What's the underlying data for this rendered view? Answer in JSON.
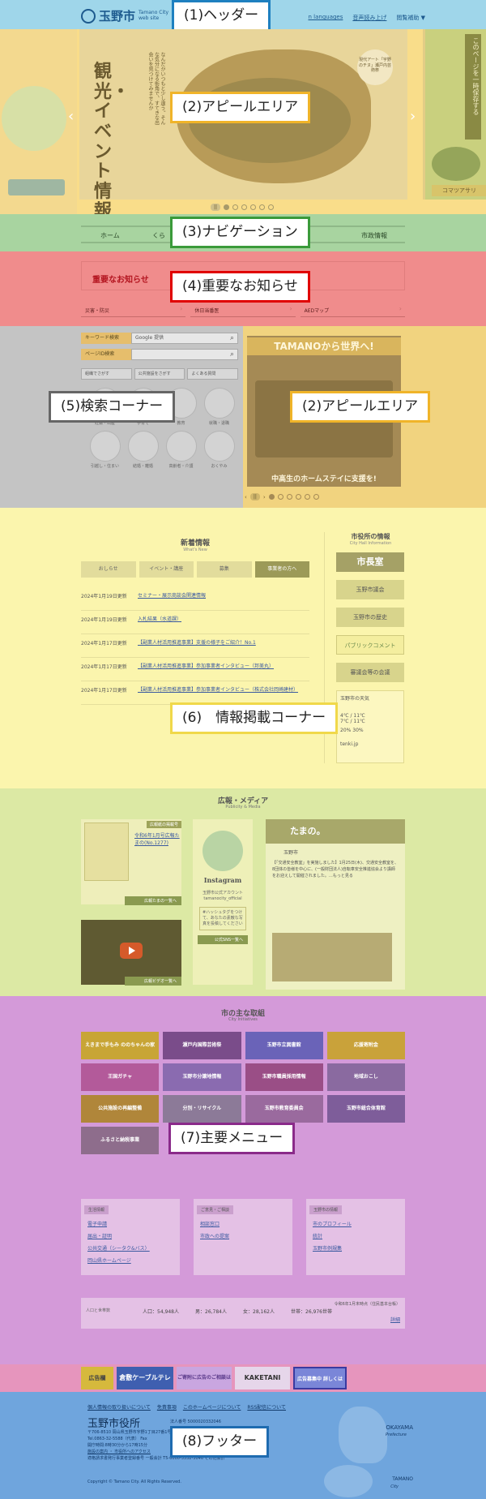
{
  "labels": {
    "header": "(1)ヘッダー",
    "appeal_top": "(2)アピールエリア",
    "nav": "(3)ナビゲーション",
    "important": "(4)重要なお知らせ",
    "search": "(5)検索コーナー",
    "appeal_right": "(2)アピールエリア",
    "info": "(6)　情報掲載コーナー",
    "menu": "(7)主要メニュー",
    "footer": "(8)フッター"
  },
  "header": {
    "logo": "玉野市",
    "logo_sub_1": "Tamano City",
    "logo_sub_2": "web site",
    "links": [
      "n languages",
      "音声読み上げ",
      "閲覧補助 ▼"
    ]
  },
  "appeal": {
    "title": "観光・イベント情報",
    "body": "なんだかいつもと少し違う。そんな気分になる街角で、すてきな出会いを見つけてみませんか",
    "tag": "現代アート「宇野のチヌ」瀬戸内芸術祭",
    "right_vertical": "このページを一時保存する",
    "right_bank": "コマツアサリ",
    "prev": "‹",
    "next": "›",
    "pause": "||"
  },
  "nav": {
    "items": [
      "ホーム",
      "くら",
      "市政情報"
    ]
  },
  "important": {
    "title": "重要なお知らせ",
    "links": [
      "災害・防災",
      "休日当番医",
      "AEDマップ"
    ]
  },
  "search": {
    "keyword_label": "キーワード検索",
    "keyword_placeholder": "Google 提供",
    "page_id_label": "ページID検索",
    "quick": [
      "組織でさがす",
      "公共施設をさがす",
      "よくある質問"
    ],
    "icons": [
      "妊娠・出産",
      "子育て",
      "教育",
      "就職・退職",
      "引越し・住まい",
      "結婚・離婚",
      "高齢者・介護",
      "おくやみ"
    ]
  },
  "appeal2": {
    "banner": "TAMANOから世界へ!",
    "caption": "中高生のホームステイに支援を!",
    "prev": "‹",
    "next": "›",
    "pause": "||"
  },
  "info": {
    "heading": "新着情報",
    "heading_sub": "What's New",
    "tabs": [
      "おしらせ",
      "イベント・講座",
      "募集",
      "事業者の方へ"
    ],
    "news": [
      {
        "date": "2024年1月19日更新",
        "title": "セミナー・展示商談会関連情報"
      },
      {
        "date": "2024年1月19日更新",
        "title": "入札結果（水道課）"
      },
      {
        "date": "2024年1月17日更新",
        "title": "【副業人材活用推進事業】支援の様子をご紹介！No.1"
      },
      {
        "date": "2024年1月17日更新",
        "title": "【副業人材活用推進事業】参加事業者インタビュー（邦美丸）"
      },
      {
        "date": "2024年1月17日更新",
        "title": "【副業人材活用推進事業】参加事業者インタビュー（株式会社岡崎建材）"
      }
    ],
    "side_heading": "市役所の情報",
    "side_sub": "City Hall Information",
    "side_banners": [
      "市長室",
      "玉野市議会",
      "玉野市の歴史",
      "パブリックコメント",
      "審議会等の会議"
    ],
    "weather_title": "玉野市の天気",
    "weather_1": "4℃ / 11℃",
    "weather_2": "7℃ / 11℃",
    "weather_pct_1": "20%",
    "weather_pct_2": "30%",
    "weather_src": "tenki.jp"
  },
  "media": {
    "heading": "広報・メディア",
    "heading_sub": "Publicity & Media",
    "kohou_tag": "広報紙の掲載号",
    "kohou_link": "令和6年1月号広報たまの(No.1277)",
    "kohou_more": "広報たまの一覧へ",
    "video_more": "広報ビデオ一覧へ",
    "insta": "Instagram",
    "insta_text": "玉野市公式アカウント tamanocity_official",
    "insta_note": "#ハッシュタグをつけて、あなたの素敵な写真を投稿してください",
    "insta_more": "公式SNS一覧へ",
    "fb_top": "たまの。",
    "fb_name": "玉野市",
    "fb_body": "【「交通安全教室」を実施しました】1月25日(木)、交通安全教室を、8団体の皆様を中心に、(一般財団法人)自転車安全推進協会より講師をお迎えして開催されました。…もっと見る"
  },
  "menu": {
    "heading": "市の主な取組",
    "heading_sub": "City Initiatives",
    "banners": [
      "えきまで手もみ ののちゃんの家",
      "瀬戸内国際芸術祭",
      "玉野市立図書館",
      "応援寄附金",
      "王国ガチャ",
      "玉野市分譲地情報",
      "玉野市職員採用情報",
      "地域おこし",
      "公共施設の再編整備",
      "分別・リサイクル",
      "玉野市教育委員会",
      "玉野市総合体育館",
      "ふるさと納税事業"
    ],
    "panels": [
      {
        "head": "生活情報",
        "links": [
          "電子申請",
          "届出・証明",
          "公共交通（シータク&バス）",
          "岡山県ホームページ"
        ]
      },
      {
        "head": "ご意見・ご相談",
        "links": [
          "相談窓口",
          "市政への提案"
        ]
      },
      {
        "head": "玉野市の情報",
        "links": [
          "市のプロフィール",
          "統計",
          "玉野市例規集"
        ]
      }
    ],
    "pop_label": "人口と世帯数",
    "pop_values": [
      "人口：54,948人",
      "男：26,784人",
      "女：28,162人",
      "世帯：26,976世帯"
    ],
    "pop_asof": "令和6年1月末時点（住民基本台帳）",
    "pop_more": "詳細"
  },
  "ads": {
    "label": "広告欄",
    "items": [
      "倉敷ケーブルテレビ KCT",
      "ご寄附に広告のご相談は",
      "KAKETANI",
      "広告募集中 詳しくはこちら"
    ]
  },
  "footer": {
    "links": [
      "個人情報の取り扱いについて",
      "免責事項",
      "このホームページについて",
      "RSS配信について"
    ],
    "office": "玉野市役所",
    "corp": "法人番号 5000020332046",
    "addr_1": "〒706-8510 岡山県玉野市宇野1丁目27番1号",
    "addr_2": "Tel.0863-32-5588（代表） Fax",
    "addr_3": "開庁時間:8時30分から17時15分",
    "addr_4": "施設の案内 ・ 市役所へのアクセス",
    "addr_5": "適格請求書発行事業者登録番号 一般会計 T5-0000-3332-3046 その他会計",
    "copy": "Copyright © Tamano City. All Rights Reserved.",
    "map_pref": "OKAYAMA",
    "map_pref_sub": "Prefecture",
    "map_city": "TAMANO",
    "map_city_sub": "City"
  }
}
